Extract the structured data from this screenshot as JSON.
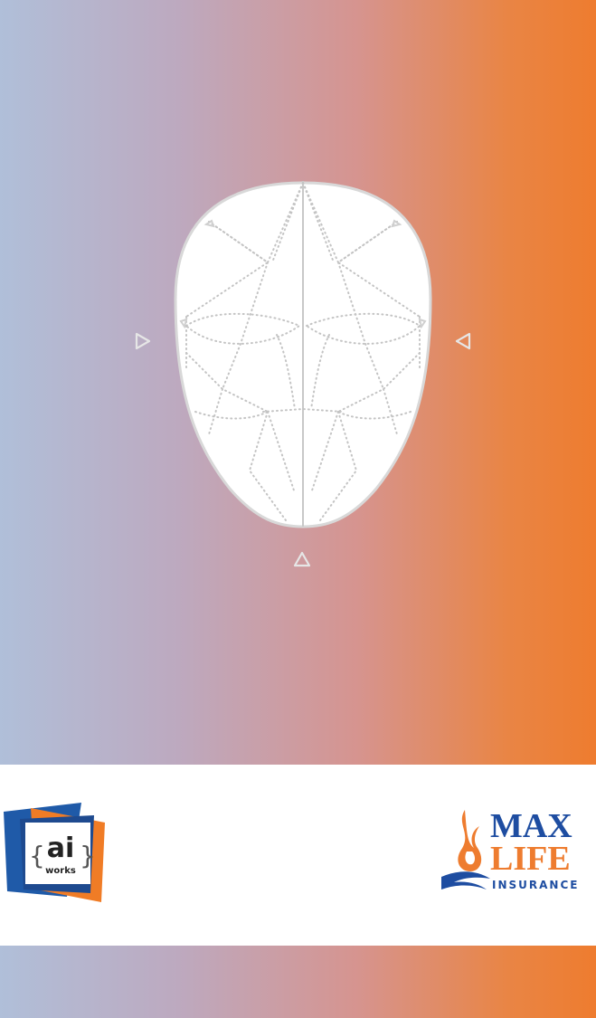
{
  "camera": {
    "guide_icon": "face-mesh-outline-icon",
    "arrows": {
      "left": "triangle-right-icon",
      "right": "triangle-left-icon",
      "bottom": "triangle-up-icon"
    }
  },
  "logos": {
    "partner": {
      "icon": "ai-works-logo",
      "ai": "ai",
      "works": "works"
    },
    "brand": {
      "icon": "max-life-flame-logo",
      "line1": "MAX",
      "line2": "LIFE",
      "line3": "INSURANCE"
    }
  },
  "colors": {
    "gradient_start": "#b0bfd9",
    "gradient_mid": "#d6948f",
    "gradient_end": "#ee7c2f",
    "brand_blue": "#1e4da1",
    "brand_orange": "#ee7c2f"
  }
}
